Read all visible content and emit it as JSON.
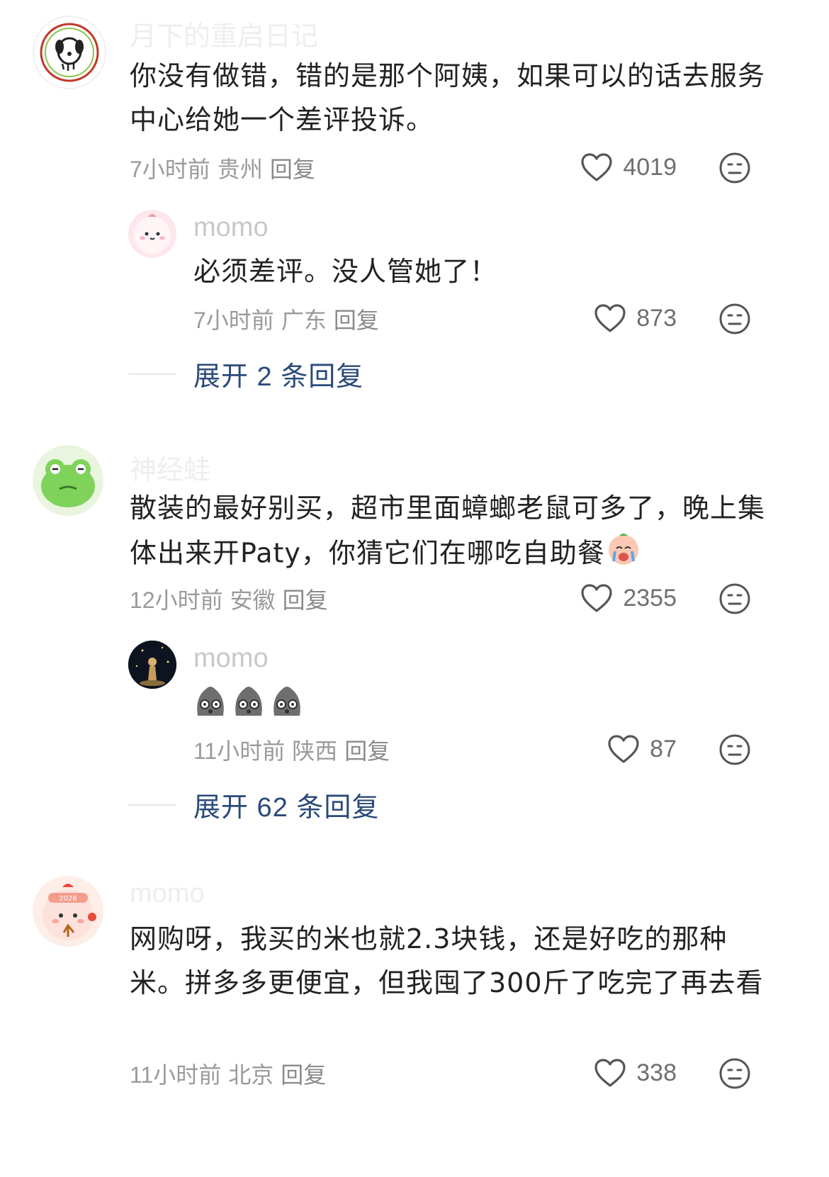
{
  "comments": [
    {
      "username": "月下的重启日记",
      "content": "你没有做错，错的是那个阿姨，如果可以的话去服务中心给她一个差评投诉。",
      "time": "7小时前",
      "location": "贵州",
      "reply_label": "回复",
      "likes": "4019",
      "reply": {
        "username": "momo",
        "content": "必须差评。没人管她了！",
        "time": "7小时前",
        "location": "广东",
        "reply_label": "回复",
        "likes": "873"
      },
      "expand_label": "展开 2 条回复"
    },
    {
      "username": "神经蛙",
      "content": "散装的最好别买，超市里面蟑螂老鼠可多了，晚上集体出来开Paty，你猜它们在哪吃自助餐",
      "time": "12小时前",
      "location": "安徽",
      "reply_label": "回复",
      "likes": "2355",
      "reply": {
        "username": "momo",
        "time": "11小时前",
        "location": "陕西",
        "reply_label": "回复",
        "likes": "87"
      },
      "expand_label": "展开 62 条回复"
    },
    {
      "username": "momo",
      "content": "网购呀，我买的米也就2.3块钱，还是好吃的那种米。拼多多更便宜，但我囤了300斤了吃完了再去看",
      "time": "11小时前",
      "location": "北京",
      "reply_label": "回复",
      "likes": "338",
      "avatar_badge": "2026"
    }
  ],
  "icons": {
    "like": "heart-outline-icon",
    "dislike": "neutral-face-icon"
  },
  "colors": {
    "expand_link": "#2b4a7a",
    "meta_text": "#9a9a9a"
  }
}
